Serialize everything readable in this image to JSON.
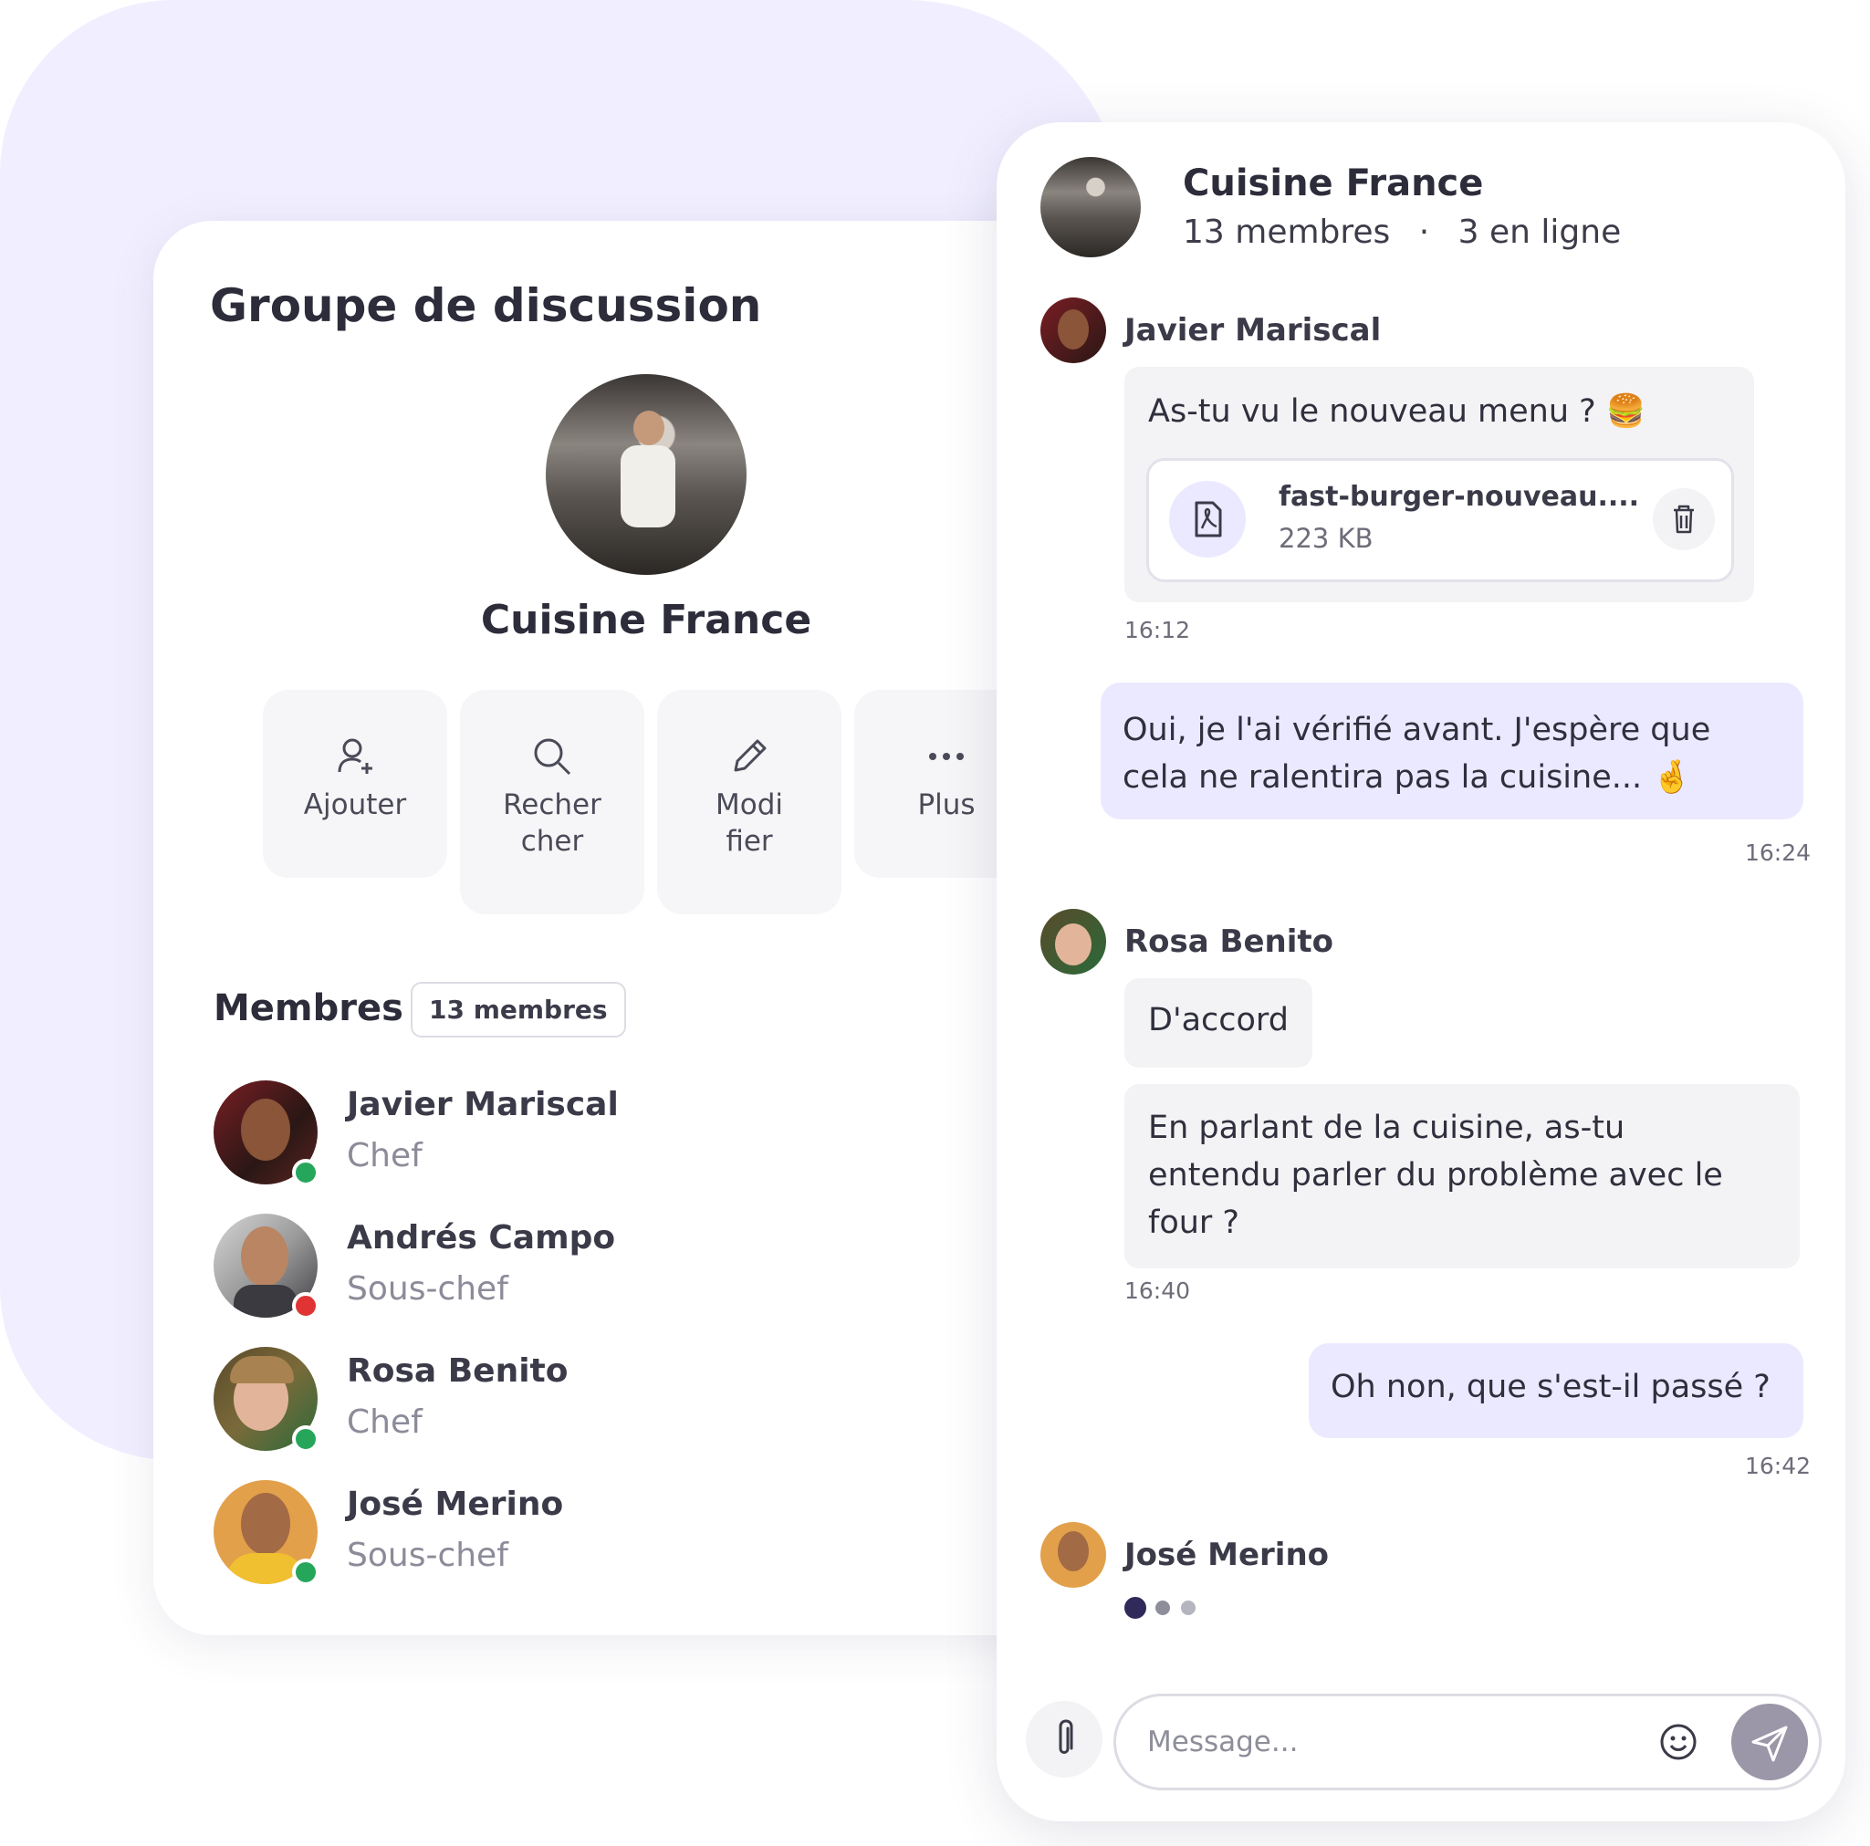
{
  "left_panel": {
    "title": "Groupe de discussion",
    "group_name": "Cuisine France",
    "actions": [
      {
        "label_1": "Ajouter",
        "label_2": "",
        "icon": "add-user-icon"
      },
      {
        "label_1": "Recher",
        "label_2": "cher",
        "icon": "search-icon"
      },
      {
        "label_1": "Modi",
        "label_2": "fier",
        "icon": "pencil-icon"
      },
      {
        "label_1": "Plus",
        "label_2": "",
        "icon": "more-icon"
      }
    ],
    "members_title": "Membres",
    "members_badge": "13 membres",
    "members": [
      {
        "name": "Javier Mariscal",
        "role": "Chef",
        "status": "online"
      },
      {
        "name": "Andrés Campo",
        "role": "Sous-chef",
        "status": "offline"
      },
      {
        "name": "Rosa Benito",
        "role": "Chef",
        "status": "online"
      },
      {
        "name": "José Merino",
        "role": "Sous-chef",
        "status": "online"
      }
    ]
  },
  "chat": {
    "group_name": "Cuisine France",
    "members_count": "13 membres",
    "separator": "·",
    "online_count": "3 en ligne",
    "messages": [
      {
        "sender": "Javier Mariscal",
        "text": "As-tu vu le nouveau menu ? 🍔",
        "file_name": "fast-burger-nouveau....",
        "file_size": "223 KB",
        "time": "16:12"
      },
      {
        "text_1": "Oui, je l'ai vérifié avant. J'espère que",
        "text_2": "cela ne ralentira pas la cuisine... 🤞",
        "time": "16:24"
      },
      {
        "sender": "Rosa Benito",
        "text": "D'accord",
        "text_b1": "En parlant de la cuisine, as-tu",
        "text_b2": "entendu parler du problème avec le",
        "text_b3": "four ?",
        "time": "16:40"
      },
      {
        "text": "Oh non, que s'est-il passé ?",
        "time": "16:42"
      },
      {
        "sender": "José Merino"
      }
    ],
    "input_placeholder": "Message..."
  },
  "colors": {
    "background_blob": "#f1efff",
    "outgoing_bubble": "#ebe9ff",
    "incoming_bubble": "#f3f3f5",
    "online": "#26a65b",
    "offline": "#e03434",
    "accent_dark": "#2f2a5a",
    "send_button": "#9b97a8"
  }
}
